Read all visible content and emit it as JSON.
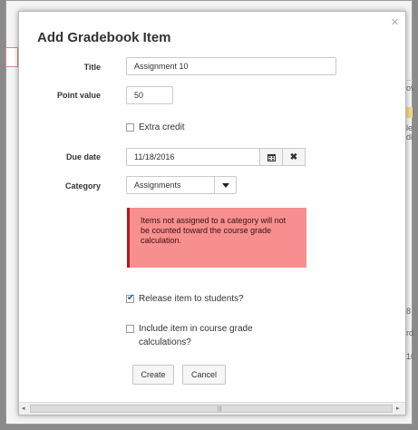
{
  "modal": {
    "title": "Add Gradebook Item",
    "close_glyph": "×"
  },
  "form": {
    "title_label": "Title",
    "title_value": "Assignment 10",
    "point_value_label": "Point value",
    "point_value": "50",
    "extra_credit_label": "Extra credit",
    "extra_credit_checked": false,
    "due_date_label": "Due date",
    "due_date_value": "11/18/2016",
    "category_label": "Category",
    "category_selected": "Assignments",
    "alert_text": "Items not assigned to a category will not be counted toward the course grade calculation.",
    "release_label": "Release item to students?",
    "release_checked": true,
    "include_label": "Include item in course grade calculations?",
    "include_checked": false
  },
  "buttons": {
    "create": "Create",
    "cancel": "Cancel"
  },
  "icons": {
    "calendar": "calendar-icon",
    "clear": "clear-icon",
    "dropdown": "chevron-down-icon"
  },
  "background_text": [
    "ov",
    "le",
    "di",
    "8 5",
    "rd",
    "10"
  ],
  "colors": {
    "alert_bg": "#f78f8f",
    "alert_border": "#b01a1a",
    "check_mark": "#2a5bb5"
  }
}
